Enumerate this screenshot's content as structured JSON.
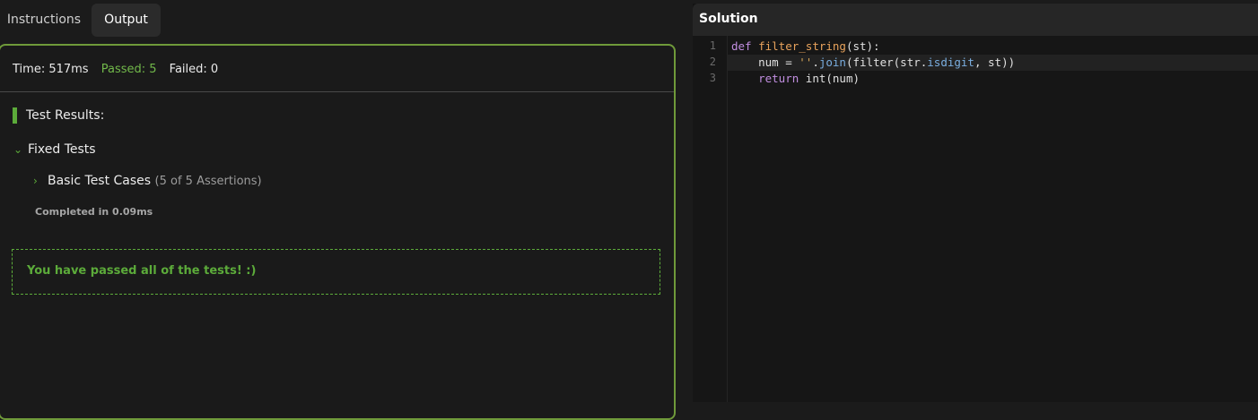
{
  "tabs": {
    "instructions": "Instructions",
    "output": "Output"
  },
  "stats": {
    "time": "Time: 517ms",
    "passed": "Passed: 5",
    "failed": "Failed: 0"
  },
  "results": {
    "title": "Test Results:",
    "group_label": "Fixed Tests",
    "case_label": "Basic Test Cases",
    "case_assertions": "(5 of 5 Assertions)",
    "completed": "Completed in 0.09ms",
    "pass_message": "You have passed all of the tests! :)"
  },
  "solution": {
    "title": "Solution",
    "line_numbers": [
      "1",
      "2",
      "3"
    ],
    "code": {
      "l1_def": "def",
      "l1_name": "filter_string",
      "l1_rest": "(st):",
      "l2_a": "    num = ",
      "l2_str": "''",
      "l2_dot": ".",
      "l2_join": "join",
      "l2_b": "(filter(str.",
      "l2_isdigit": "isdigit",
      "l2_c": ", st))",
      "l3_a": "    ",
      "l3_return": "return",
      "l3_b": " int(num)"
    }
  },
  "colors": {
    "accent_green": "#5cab3a",
    "panel_border": "#6f9a3a"
  }
}
